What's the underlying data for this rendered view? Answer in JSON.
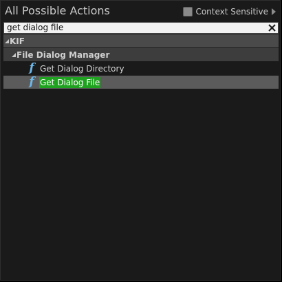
{
  "header": {
    "title": "All Possible Actions",
    "context_sensitive_label": "Context Sensitive",
    "context_sensitive_checked": false
  },
  "search": {
    "value": "get dialog file",
    "clear_icon": "close-icon"
  },
  "tree": {
    "categories": [
      {
        "label": "KIF",
        "expanded": true,
        "subcategories": [
          {
            "label": "File Dialog Manager",
            "expanded": true,
            "items": [
              {
                "label": "Get Dialog Directory",
                "icon": "function-icon",
                "selected": false
              },
              {
                "label": "Get Dialog File",
                "icon": "function-icon",
                "selected": true
              }
            ]
          }
        ]
      }
    ]
  },
  "colors": {
    "panel_background": "#1a1a1a",
    "selection_highlight": "#1fa21f",
    "function_icon": "#6fb7e8"
  }
}
